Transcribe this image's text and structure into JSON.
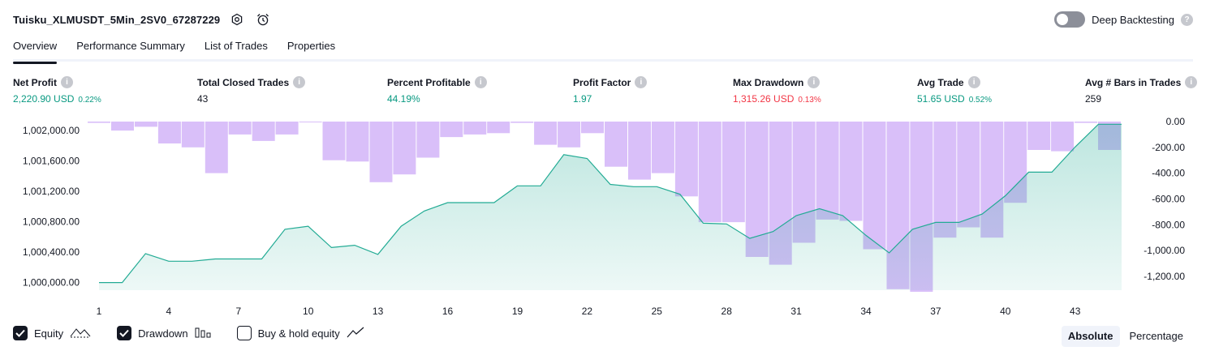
{
  "header": {
    "title": "Tuisku_XLMUSDT_5Min_2SV0_67287229",
    "deep_backtesting_label": "Deep Backtesting",
    "deep_backtesting_enabled": false
  },
  "tabs": [
    {
      "label": "Overview",
      "active": true
    },
    {
      "label": "Performance Summary",
      "active": false
    },
    {
      "label": "List of Trades",
      "active": false
    },
    {
      "label": "Properties",
      "active": false
    }
  ],
  "metrics": [
    {
      "label": "Net Profit",
      "value": "2,220.90 USD",
      "pct": "0.22%",
      "color": "green"
    },
    {
      "label": "Total Closed Trades",
      "value": "43",
      "pct": "",
      "color": "dark"
    },
    {
      "label": "Percent Profitable",
      "value": "44.19%",
      "pct": "",
      "color": "green"
    },
    {
      "label": "Profit Factor",
      "value": "1.97",
      "pct": "",
      "color": "green"
    },
    {
      "label": "Max Drawdown",
      "value": "1,315.26 USD",
      "pct": "0.13%",
      "color": "red"
    },
    {
      "label": "Avg Trade",
      "value": "51.65 USD",
      "pct": "0.52%",
      "color": "green"
    },
    {
      "label": "Avg # Bars in Trades",
      "value": "259",
      "pct": "",
      "color": "dark"
    }
  ],
  "chart_data": {
    "type": "area",
    "x_ticks": [
      "1",
      "4",
      "7",
      "10",
      "13",
      "16",
      "19",
      "22",
      "25",
      "28",
      "31",
      "34",
      "37",
      "40",
      "43"
    ],
    "left_axis_ticks": [
      "1,000,000.00",
      "1,000,400.00",
      "1,000,800.00",
      "1,001,200.00",
      "1,001,600.00",
      "1,002,000.00"
    ],
    "right_axis_ticks": [
      "0.00",
      "-200.00",
      "-400.00",
      "-600.00",
      "-800.00",
      "-1,000.00",
      "-1,200.00"
    ],
    "equity_ylim": [
      999900,
      1002200
    ],
    "drawdown_ylim": [
      -1320,
      0
    ],
    "series": [
      {
        "kind": "equity",
        "color": "#22ab94",
        "values": [
          1000000,
          1000000,
          1000380,
          1000280,
          1000280,
          1000310,
          1000310,
          1000310,
          1000700,
          1000740,
          1000460,
          1000490,
          1000370,
          1000740,
          1000940,
          1001050,
          1001050,
          1001050,
          1001270,
          1001270,
          1001680,
          1001630,
          1001290,
          1001260,
          1001260,
          1001160,
          1000780,
          1000770,
          1000580,
          1000670,
          1000880,
          1000970,
          1000880,
          1000620,
          1000390,
          1000700,
          1000790,
          1000790,
          1000900,
          1001140,
          1001450,
          1001450,
          1001780,
          1002080,
          1002080
        ]
      },
      {
        "kind": "drawdown",
        "color": "#c9a4f7",
        "values": [
          -10,
          -70,
          -40,
          -170,
          -200,
          -400,
          -100,
          -150,
          -100,
          0,
          -300,
          -310,
          -470,
          -410,
          -280,
          -120,
          -100,
          -90,
          -10,
          -180,
          -200,
          -90,
          -350,
          -450,
          -400,
          -580,
          -780,
          -780,
          -1050,
          -1110,
          -940,
          -760,
          -770,
          -990,
          -1300,
          -1320,
          -900,
          -820,
          -900,
          -630,
          -220,
          -230,
          -10,
          -220
        ]
      }
    ]
  },
  "legend": [
    {
      "label": "Equity",
      "checked": true,
      "icon": "equity-line-icon"
    },
    {
      "label": "Drawdown",
      "checked": true,
      "icon": "drawdown-bars-icon"
    },
    {
      "label": "Buy & hold equity",
      "checked": false,
      "icon": "buy-hold-line-icon"
    }
  ],
  "display_modes": [
    {
      "label": "Absolute",
      "active": true
    },
    {
      "label": "Percentage",
      "active": false
    }
  ]
}
